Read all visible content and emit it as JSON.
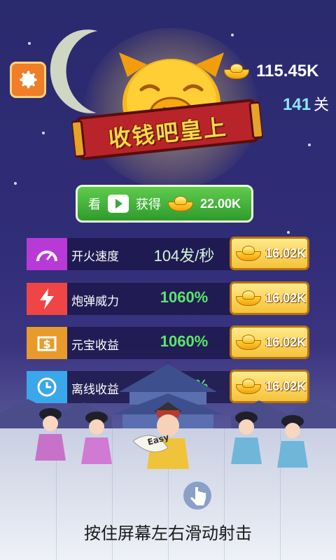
{
  "header": {
    "coins": "115.45K",
    "level_number": "141",
    "level_unit": "关"
  },
  "title_banner": "收钱吧皇上",
  "watch_ad": {
    "prefix": "看",
    "action": "获得",
    "reward": "22.00K"
  },
  "upgrades": [
    {
      "name": "开火速度",
      "value": "104发/秒",
      "price": "16.02K",
      "icon": "speedometer-icon",
      "color": "#b83ad6"
    },
    {
      "name": "炮弹威力",
      "value": "1060%",
      "price": "16.02K",
      "icon": "lightning-icon",
      "color": "#ef4545"
    },
    {
      "name": "元宝收益",
      "value": "1060%",
      "price": "16.02K",
      "icon": "money-bag-icon",
      "color": "#e89b2a"
    },
    {
      "name": "离线收益",
      "value": "1060%",
      "price": "16.02K",
      "icon": "clock-icon",
      "color": "#3aa7ea"
    }
  ],
  "fan_text": "Easy",
  "hint": "按住屏幕左右滑动射击"
}
